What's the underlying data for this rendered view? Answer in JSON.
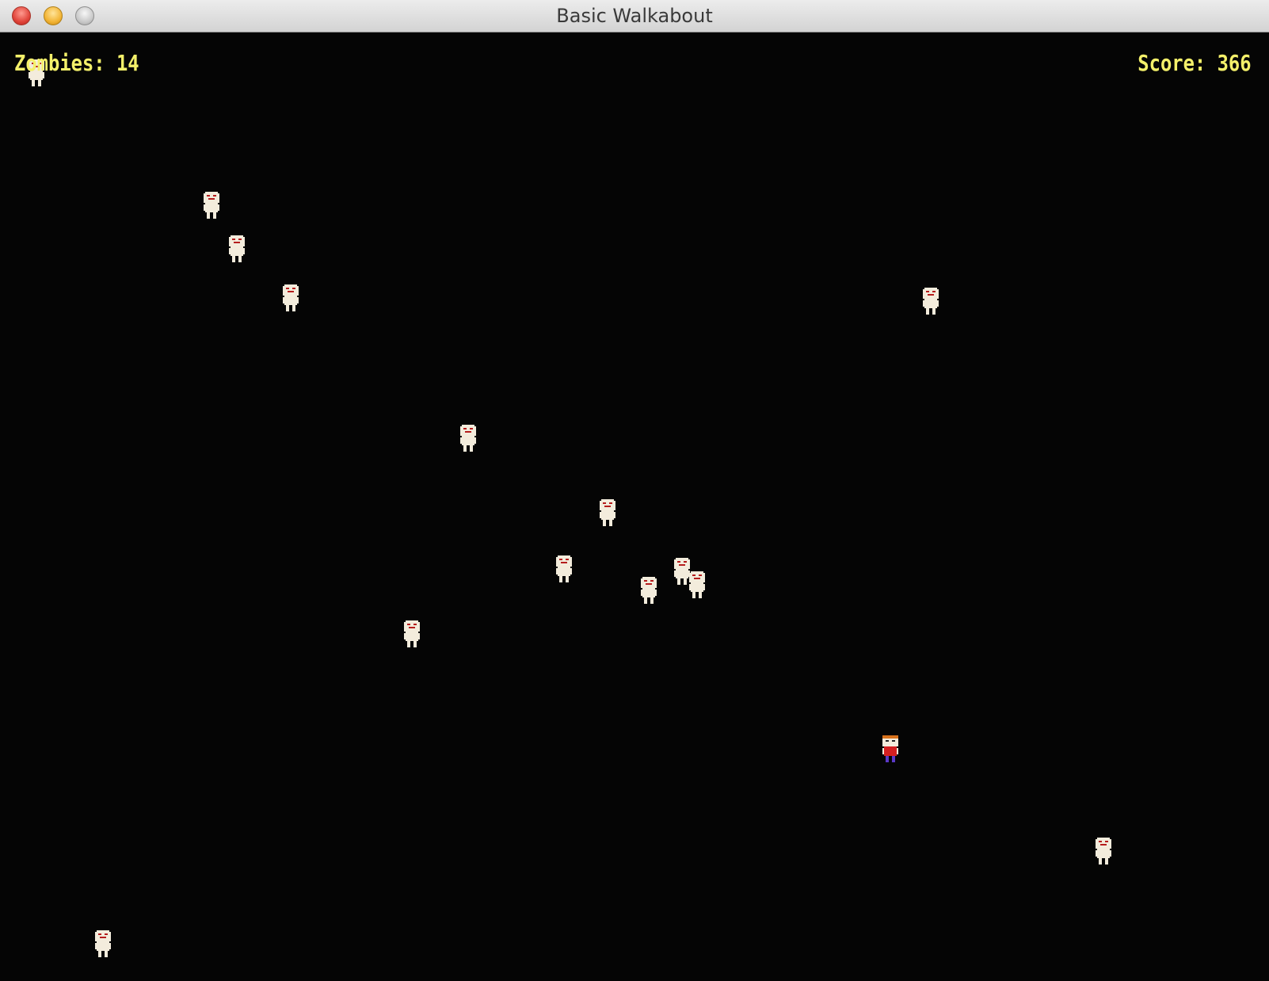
{
  "window": {
    "title": "Basic Walkabout"
  },
  "hud": {
    "zombies_label": "Zombies: 14",
    "score_label": "Score: 366",
    "text_color": "#f4f06a"
  },
  "colors": {
    "background": "#050505",
    "zombie_body": "#f3ecdc",
    "zombie_eyes": "#b51d1d",
    "player_hair": "#d8721c",
    "player_shirt": "#d42020",
    "player_pants": "#5b38c8"
  },
  "sprites": {
    "zombie": "zombie-icon",
    "player": "player-icon"
  }
}
